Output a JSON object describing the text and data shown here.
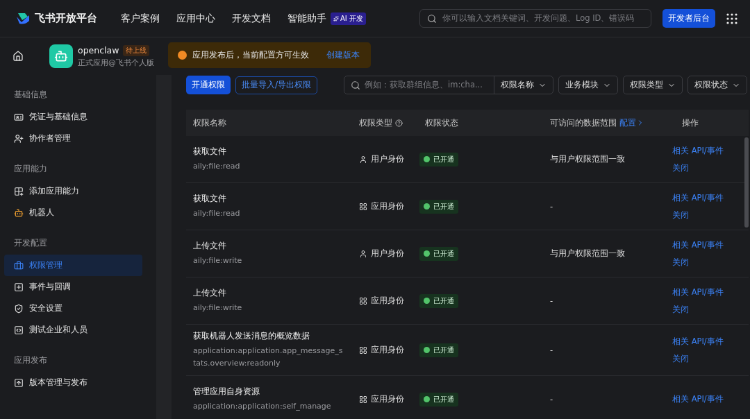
{
  "header": {
    "logo_text": "飞书开放平台",
    "nav": [
      {
        "label": "客户案例"
      },
      {
        "label": "应用中心"
      },
      {
        "label": "开发文档"
      },
      {
        "label": "智能助手",
        "badge": "AI 开发"
      }
    ],
    "search": {
      "placeholder": "你可以输入文档关键词、开发问题、Log ID、错误码"
    },
    "console_button": "开发者后台"
  },
  "app": {
    "name": "openclaw",
    "status": "待上线",
    "subtitle": "正式应用@飞书个人版"
  },
  "notice": {
    "text": "应用发布后，当前配置方可生效",
    "link": "创建版本"
  },
  "sidebar": {
    "sections": [
      {
        "title": "基础信息",
        "items": [
          {
            "label": "凭证与基础信息",
            "selected": false
          },
          {
            "label": "协作者管理",
            "selected": false
          }
        ]
      },
      {
        "title": "应用能力",
        "items": [
          {
            "label": "添加应用能力",
            "selected": false
          },
          {
            "label": "机器人",
            "selected": false
          }
        ]
      },
      {
        "title": "开发配置",
        "items": [
          {
            "label": "权限管理",
            "selected": true
          },
          {
            "label": "事件与回调",
            "selected": false
          },
          {
            "label": "安全设置",
            "selected": false
          },
          {
            "label": "测试企业和人员",
            "selected": false
          }
        ]
      },
      {
        "title": "应用发布",
        "items": [
          {
            "label": "版本管理与发布",
            "selected": false
          }
        ]
      }
    ]
  },
  "toolbar": {
    "primary_button": "开通权限",
    "secondary_button": "批量导入/导出权限",
    "search": {
      "placeholder": "例如：获取群组信息、im:cha..."
    },
    "filters": [
      "权限名称",
      "业务模块",
      "权限类型",
      "权限状态"
    ]
  },
  "table": {
    "columns": [
      {
        "label": "权限名称"
      },
      {
        "label": "权限类型",
        "help": true
      },
      {
        "label": "权限状态"
      },
      {
        "label": "可访问的数据范围",
        "link": "配置"
      },
      {
        "label": "操作"
      }
    ],
    "rows": [
      {
        "name": "获取文件",
        "scope": "aily:file:read",
        "type": {
          "kind": "user",
          "label": "用户身份"
        },
        "status": {
          "label": "已开通",
          "on": true
        },
        "range": "与用户权限范围一致",
        "actions": [
          "相关 API/事件",
          "关闭"
        ]
      },
      {
        "name": "获取文件",
        "scope": "aily:file:read",
        "type": {
          "kind": "app",
          "label": "应用身份"
        },
        "status": {
          "label": "已开通",
          "on": true
        },
        "range": "-",
        "actions": [
          "相关 API/事件",
          "关闭"
        ]
      },
      {
        "name": "上传文件",
        "scope": "aily:file:write",
        "type": {
          "kind": "user",
          "label": "用户身份"
        },
        "status": {
          "label": "已开通",
          "on": true
        },
        "range": "与用户权限范围一致",
        "actions": [
          "相关 API/事件",
          "关闭"
        ]
      },
      {
        "name": "上传文件",
        "scope": "aily:file:write",
        "type": {
          "kind": "app",
          "label": "应用身份"
        },
        "status": {
          "label": "已开通",
          "on": true
        },
        "range": "-",
        "actions": [
          "相关 API/事件",
          "关闭"
        ]
      },
      {
        "name": "获取机器人发送消息的概览数据",
        "scope": "application:application.app_message_stats.overview:readonly",
        "type": {
          "kind": "app",
          "label": "应用身份"
        },
        "status": {
          "label": "已开通",
          "on": true
        },
        "range": "-",
        "actions": [
          "相关 API/事件",
          "关闭"
        ]
      },
      {
        "name": "管理应用自身资源",
        "scope": "application:application:self_manage",
        "type": {
          "kind": "app",
          "label": "应用身份"
        },
        "status": {
          "label": "已开通",
          "on": true
        },
        "range": "-",
        "actions": [
          "相关 API/事件"
        ]
      }
    ]
  }
}
